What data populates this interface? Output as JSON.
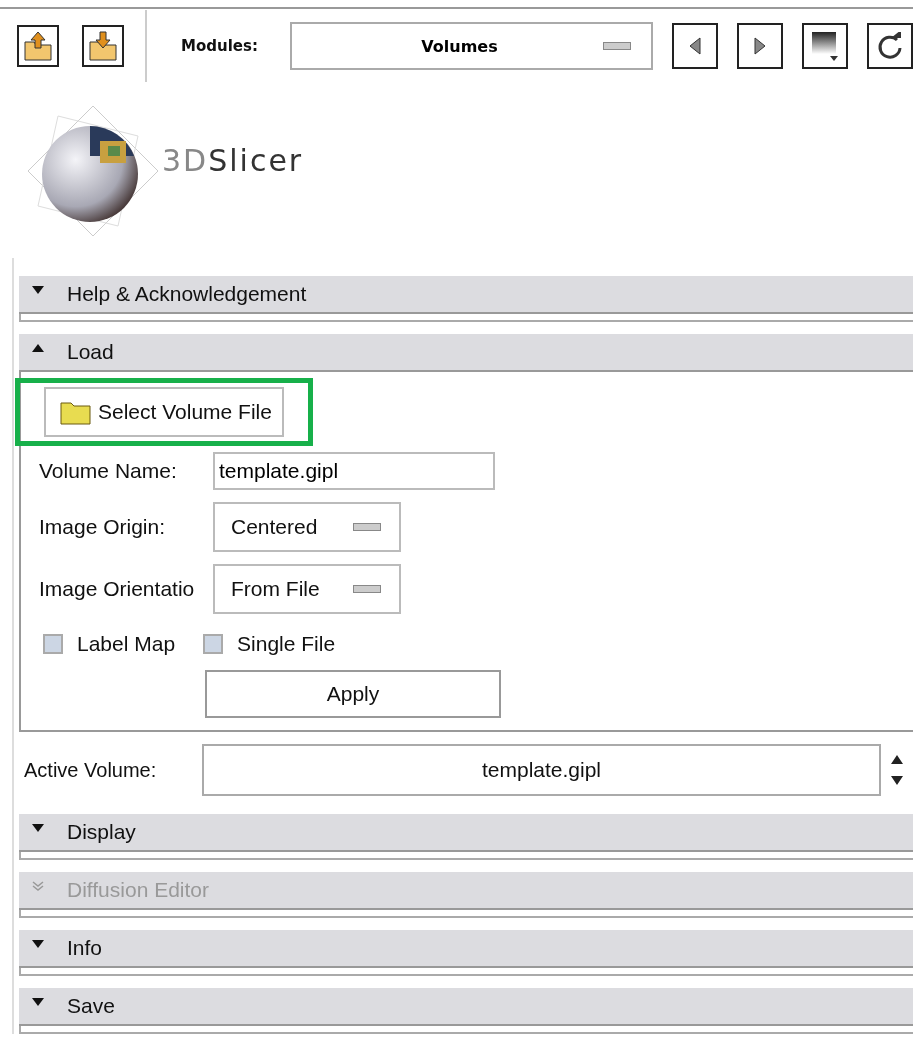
{
  "toolbar": {
    "modules_label": "Modules:",
    "module": "Volumes"
  },
  "logo": {
    "prefix": "3D",
    "name": "Slicer"
  },
  "panels": [
    {
      "kind": "section",
      "title": "Help & Acknowledgement",
      "expanded": false,
      "disabled": false
    },
    {
      "kind": "section",
      "title": "Load",
      "expanded": true,
      "disabled": false,
      "body": {
        "select_button": {
          "label": "Select Volume File",
          "highlighted": true
        },
        "volume_name": {
          "label": "Volume Name:",
          "value": "template.gipl"
        },
        "image_origin": {
          "label": "Image Origin:",
          "value": "Centered"
        },
        "image_orientation": {
          "label": "Image Orientatio",
          "value": "From File"
        },
        "checkboxes": [
          {
            "label": "Label Map",
            "checked": false
          },
          {
            "label": "Single File",
            "checked": false
          }
        ],
        "apply_button": "Apply"
      }
    },
    {
      "kind": "selector",
      "label": "Active Volume:",
      "value": "template.gipl"
    },
    {
      "kind": "section",
      "title": "Display",
      "expanded": false,
      "disabled": false
    },
    {
      "kind": "section",
      "title": "Diffusion Editor",
      "expanded": false,
      "disabled": true
    },
    {
      "kind": "section",
      "title": "Info",
      "expanded": false,
      "disabled": false
    },
    {
      "kind": "section",
      "title": "Save",
      "expanded": false,
      "disabled": false
    }
  ]
}
